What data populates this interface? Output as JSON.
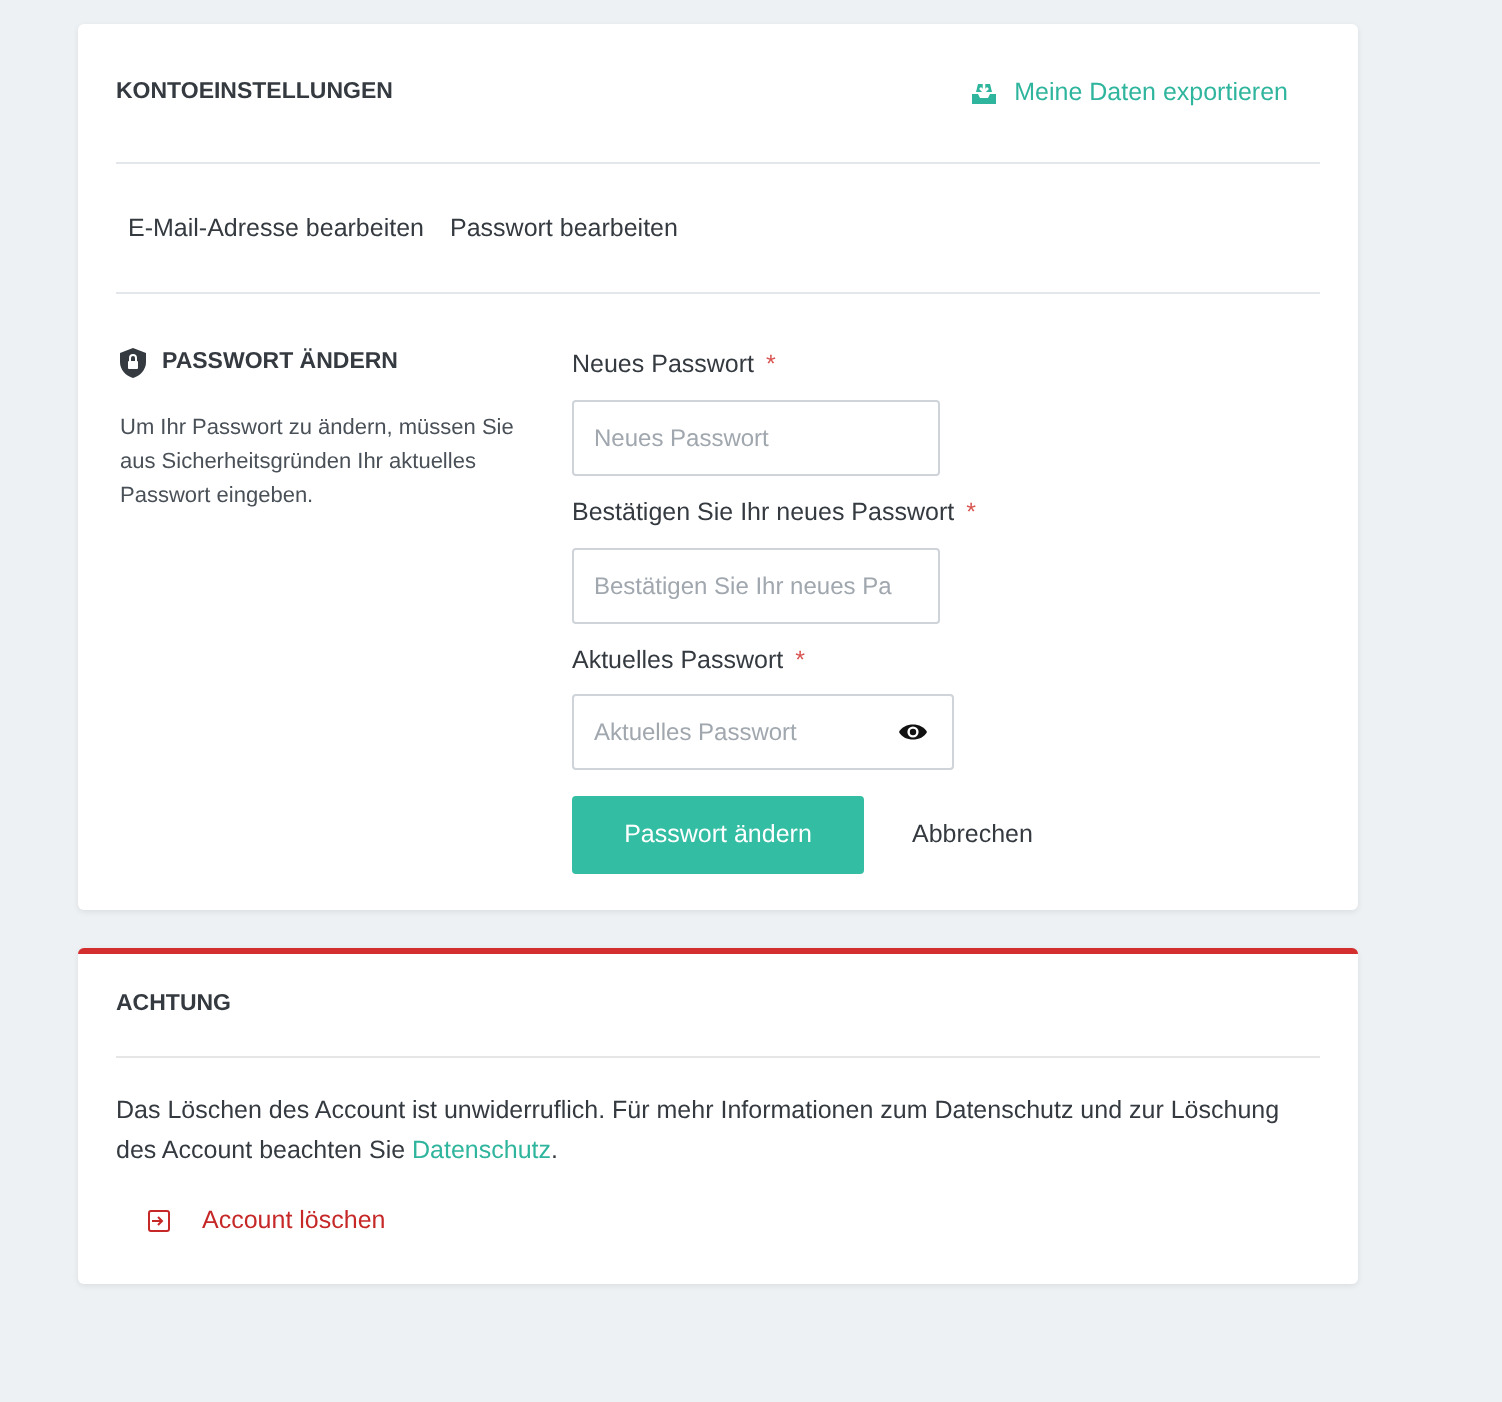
{
  "account_settings": {
    "title": "KONTOEINSTELLUNGEN",
    "export_link": "Meine Daten exportieren",
    "tabs": [
      "E-Mail-Adresse bearbeiten",
      "Passwort bearbeiten"
    ],
    "section": {
      "title": "PASSWORT ÄNDERN",
      "description": "Um Ihr Passwort zu ändern, müssen Sie aus Sicherheitsgründen Ihr aktuelles Passwort eingeben."
    },
    "fields": [
      {
        "label": "Neues Passwort",
        "required_mark": "*",
        "placeholder": "Neues Passwort",
        "kind": "text"
      },
      {
        "label": "Bestätigen Sie Ihr neues Passwort",
        "required_mark": "*",
        "placeholder": "Bestätigen Sie Ihr neues Pa",
        "kind": "text"
      },
      {
        "label": "Aktuelles Passwort",
        "required_mark": "*",
        "placeholder": "Aktuelles Passwort",
        "kind": "reveal"
      }
    ],
    "submit_button": "Passwort ändern",
    "cancel_link": "Abbrechen"
  },
  "warning": {
    "title": "ACHTUNG",
    "text_before": "Das Löschen des Account ist unwiderruflich. Für mehr Informationen zum Datenschutz und zur Löschung des Account beachten Sie ",
    "link": "Datenschutz",
    "text_after": ".",
    "delete_link": "Account löschen"
  }
}
